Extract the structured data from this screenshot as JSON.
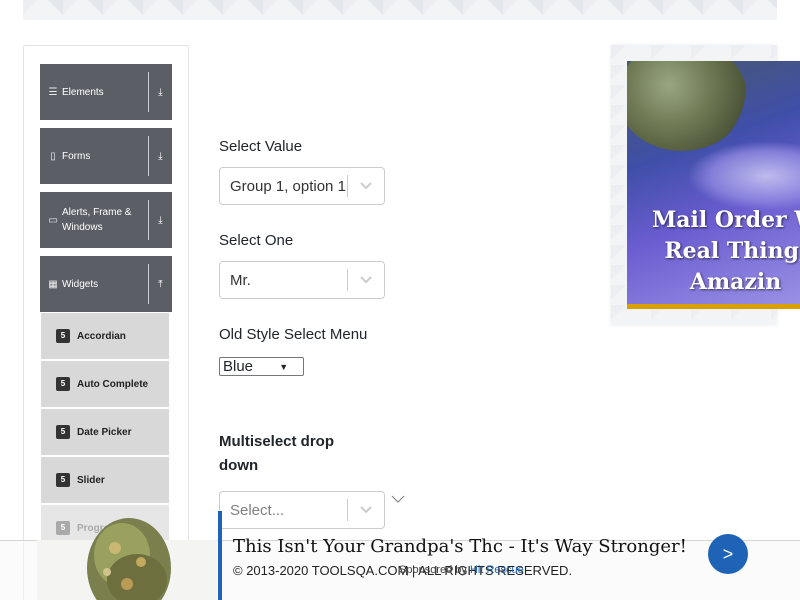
{
  "sidebar": {
    "groups": [
      {
        "label": "Elements",
        "icon": "hamburger-icon",
        "toggle": "⤓"
      },
      {
        "label": "Forms",
        "icon": "form-icon",
        "toggle": "⤓"
      },
      {
        "label": "Alerts, Frame & Windows",
        "icon": "window-icon",
        "toggle": "⤓"
      },
      {
        "label": "Widgets",
        "icon": "grid-icon",
        "toggle": "⤒"
      }
    ],
    "items": [
      {
        "label": "Accordian"
      },
      {
        "label": "Auto Complete"
      },
      {
        "label": "Date Picker"
      },
      {
        "label": "Slider"
      },
      {
        "label": "Progress Bar"
      }
    ]
  },
  "form": {
    "select_value": {
      "label": "Select Value",
      "value": "Group 1, option 1"
    },
    "select_one": {
      "label": "Select One",
      "value": "Mr."
    },
    "old_style": {
      "label": "Old Style Select Menu",
      "value": "Blue"
    },
    "multiselect": {
      "label": "Multiselect drop down",
      "placeholder": "Select..."
    }
  },
  "ad_right": {
    "headline_lines": [
      "Mail Order W",
      "Real Thing,",
      "Amazin"
    ]
  },
  "footer": {
    "copyright": "© 2013-2020 TOOLSQA.COM | ALL RIGHTS RESERVED."
  },
  "bottom_ad": {
    "title": "This Isn't Your Grandpa's Thc - It's Way Stronger!",
    "sponsored_prefix": "Sponsored by",
    "sponsor": "Hit Rescue",
    "go": ">"
  },
  "colors": {
    "sidebar_header": "#5b5e64",
    "menu_item": "#d8d8d8",
    "accent_blue": "#1e63b6",
    "gold": "#d9a000"
  }
}
